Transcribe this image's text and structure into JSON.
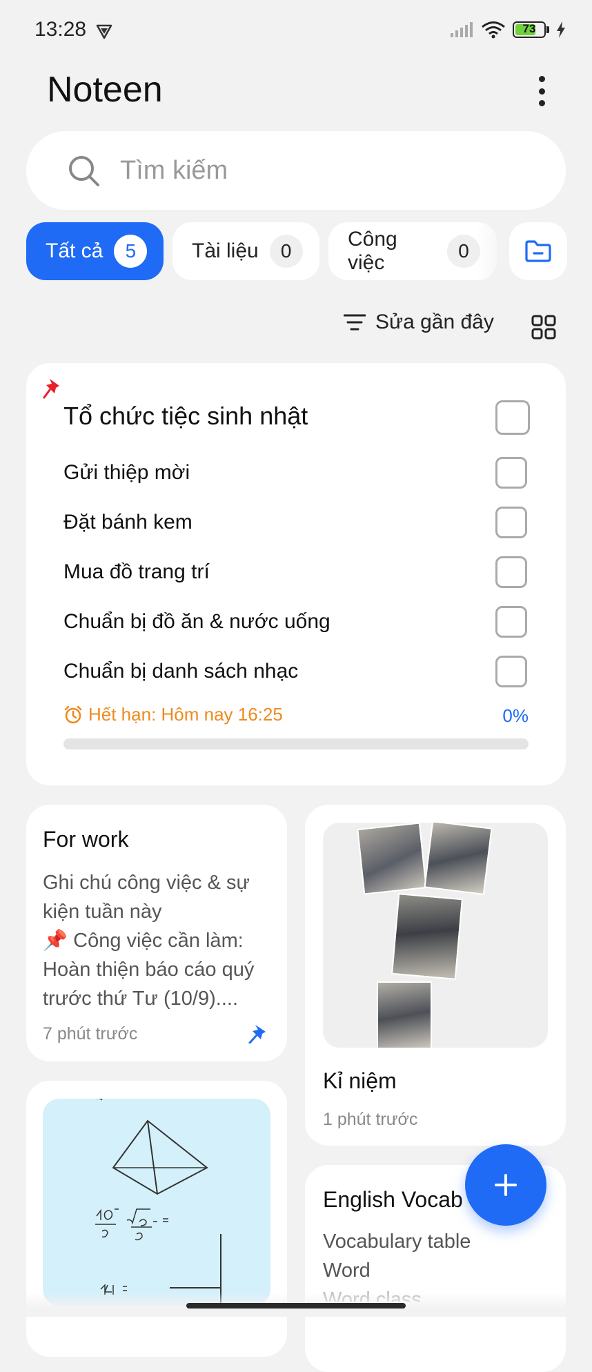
{
  "status_bar": {
    "time": "13:28",
    "battery_level": "73",
    "battery_fraction": 0.73,
    "icons": [
      "vpn-icon",
      "signal-icon",
      "wifi-icon",
      "battery-icon",
      "charging-icon"
    ]
  },
  "header": {
    "title": "Noteen"
  },
  "search": {
    "placeholder": "Tìm kiếm"
  },
  "categories": [
    {
      "label": "Tất cả",
      "count": "5",
      "active": true
    },
    {
      "label": "Tài liệu",
      "count": "0",
      "active": false
    },
    {
      "label": "Công việc",
      "count": "0",
      "active": false
    }
  ],
  "sort": {
    "label": "Sửa gần đây"
  },
  "checklist_card": {
    "title": "Tổ chức tiệc sinh nhật",
    "items": [
      "Gửi thiệp mời",
      "Đặt bánh kem",
      "Mua đồ trang trí",
      "Chuẩn bị đồ ăn & nước uống",
      "Chuẩn bị danh sách nhạc"
    ],
    "due": "Hết hạn: Hôm nay 16:25",
    "percent": "0%",
    "progress_fraction": 0
  },
  "notes": [
    {
      "title": "For work",
      "body": "Ghi chú công việc & sự kiện tuần này\n📌 Công việc cần làm: Hoàn thiện báo cáo quý trước thứ Tư (10/9)....",
      "time": "7 phút trước"
    },
    {
      "title": "Kỉ niệm",
      "time": "1 phút trước"
    },
    {
      "title": "English Vocab",
      "lines": [
        "Vocabulary table",
        "Word",
        "Word class"
      ]
    }
  ],
  "colors": {
    "accent": "#1f6bf5",
    "due": "#ee8a1e",
    "background": "#f2f2f2"
  }
}
